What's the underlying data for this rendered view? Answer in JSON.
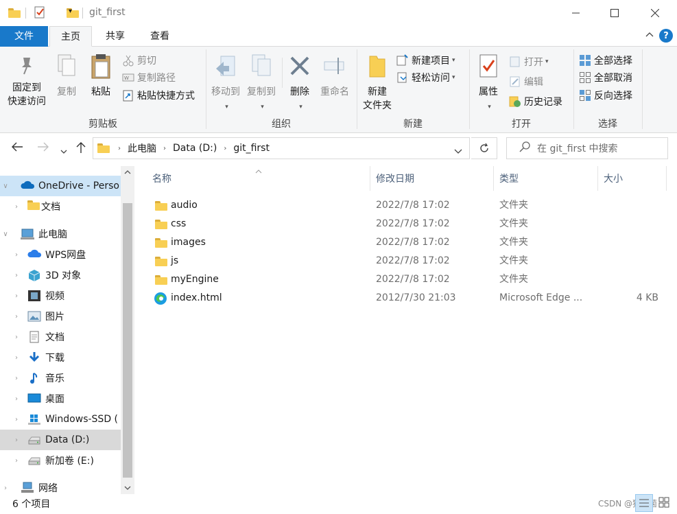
{
  "window": {
    "title": "git_first"
  },
  "tabs": [
    "文件",
    "主页",
    "共享",
    "查看"
  ],
  "ribbon": {
    "clipboard": {
      "group": "剪贴板",
      "pin": "固定到\n快速访问",
      "copy": "复制",
      "paste": "粘贴",
      "cut": "剪切",
      "copy_path": "复制路径",
      "paste_shortcut": "粘贴快捷方式"
    },
    "organize": {
      "group": "组织",
      "move_to": "移动到",
      "copy_to": "复制到",
      "delete": "删除",
      "rename": "重命名"
    },
    "new": {
      "group": "新建",
      "new_folder": "新建\n文件夹",
      "new_item": "新建项目",
      "easy_access": "轻松访问"
    },
    "open": {
      "group": "打开",
      "properties": "属性",
      "open": "打开",
      "edit": "编辑",
      "history": "历史记录"
    },
    "select": {
      "group": "选择",
      "select_all": "全部选择",
      "select_none": "全部取消",
      "invert": "反向选择"
    }
  },
  "address": {
    "parts": [
      "此电脑",
      "Data (D:)",
      "git_first"
    ],
    "search_placeholder": "在 git_first 中搜索"
  },
  "nav_pane": [
    {
      "label": "OneDrive - Perso",
      "icon": "onedrive-icon"
    },
    {
      "label": "文档",
      "icon": "folder-icon"
    },
    {
      "label": "此电脑",
      "icon": "computer-icon"
    },
    {
      "label": "WPS网盘",
      "icon": "wps-cloud-icon"
    },
    {
      "label": "3D 对象",
      "icon": "3d-objects-icon"
    },
    {
      "label": "视频",
      "icon": "videos-icon"
    },
    {
      "label": "图片",
      "icon": "pictures-icon"
    },
    {
      "label": "文档",
      "icon": "documents-icon"
    },
    {
      "label": "下载",
      "icon": "downloads-icon"
    },
    {
      "label": "音乐",
      "icon": "music-icon"
    },
    {
      "label": "桌面",
      "icon": "desktop-icon"
    },
    {
      "label": "Windows-SSD (",
      "icon": "windows-drive-icon"
    },
    {
      "label": "Data (D:)",
      "icon": "drive-icon"
    },
    {
      "label": "新加卷 (E:)",
      "icon": "drive-icon"
    },
    {
      "label": "网络",
      "icon": "network-icon"
    }
  ],
  "columns": {
    "name": "名称",
    "date": "修改日期",
    "type": "类型",
    "size": "大小"
  },
  "files": [
    {
      "name": "audio",
      "date": "2022/7/8 17:02",
      "type": "文件夹",
      "size": ""
    },
    {
      "name": "css",
      "date": "2022/7/8 17:02",
      "type": "文件夹",
      "size": ""
    },
    {
      "name": "images",
      "date": "2022/7/8 17:02",
      "type": "文件夹",
      "size": ""
    },
    {
      "name": "js",
      "date": "2022/7/8 17:02",
      "type": "文件夹",
      "size": ""
    },
    {
      "name": "myEngine",
      "date": "2022/7/8 17:02",
      "type": "文件夹",
      "size": ""
    },
    {
      "name": "index.html",
      "date": "2012/7/30 21:03",
      "type": "Microsoft Edge ...",
      "size": "4 KB"
    }
  ],
  "status": {
    "count": "6 个项目",
    "watermark": "CSDN @猿猫菌"
  },
  "colors": {
    "accent": "#1979ca",
    "folder": "#f8cf54",
    "selected": "#cce4f7"
  }
}
